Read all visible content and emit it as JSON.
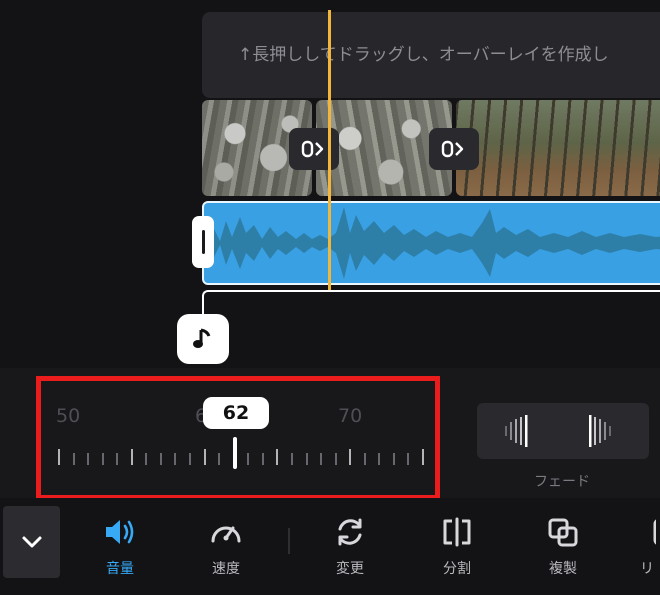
{
  "timeline": {
    "overlay_hint": "↑長押ししてドラッグし、オーバーレイを作成し",
    "transition_icon": "transition-icon",
    "music_icon": "music-note-icon",
    "playhead_color": "#f0b73a",
    "audio_color": "#3aa0e4"
  },
  "volume": {
    "value": "62",
    "ruler_labels": [
      "50",
      "60",
      "70"
    ],
    "highlight_color": "#ea1c1c"
  },
  "fade": {
    "label": "フェード"
  },
  "toolbar": {
    "items": [
      {
        "label": "音量",
        "icon": "speaker-icon",
        "active": true
      },
      {
        "label": "速度",
        "icon": "speed-gauge-icon",
        "active": false
      },
      {
        "label": "変更",
        "icon": "replace-icon",
        "active": false
      },
      {
        "label": "分割",
        "icon": "split-icon",
        "active": false
      },
      {
        "label": "複製",
        "icon": "duplicate-icon",
        "active": false
      },
      {
        "label": "リ",
        "icon": "more-icon",
        "active": false
      }
    ],
    "accent_color": "#37a9f5"
  }
}
